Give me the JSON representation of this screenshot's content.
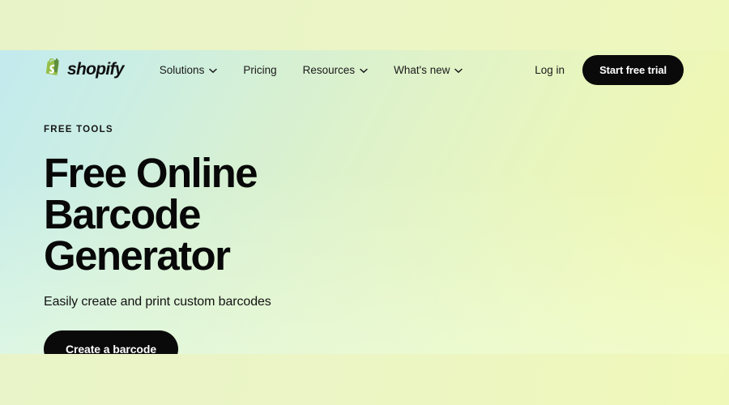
{
  "brand": {
    "name": "shopify",
    "logo_icon": "shopify-bag-icon",
    "logo_color": "#95bf47",
    "logo_letter": "S"
  },
  "nav": {
    "items": [
      {
        "label": "Solutions",
        "has_dropdown": true,
        "icon": "chevron-down-icon"
      },
      {
        "label": "Pricing",
        "has_dropdown": false,
        "icon": ""
      },
      {
        "label": "Resources",
        "has_dropdown": true,
        "icon": "chevron-down-icon"
      },
      {
        "label": "What's new",
        "has_dropdown": true,
        "icon": "chevron-down-icon"
      }
    ],
    "login_label": "Log in",
    "trial_label": "Start free trial"
  },
  "hero": {
    "eyebrow": "FREE TOOLS",
    "title": "Free Online Barcode Generator",
    "subtitle": "Easily create and print custom barcodes",
    "cta_label": "Create a barcode"
  },
  "colors": {
    "accent_black": "#0a0a0a",
    "text_primary": "#080808",
    "brand_green": "#95bf47",
    "page_background": "#eaf5c2",
    "hero_gradient_start": "#c3eaee",
    "hero_gradient_end": "#f2f8ad"
  }
}
